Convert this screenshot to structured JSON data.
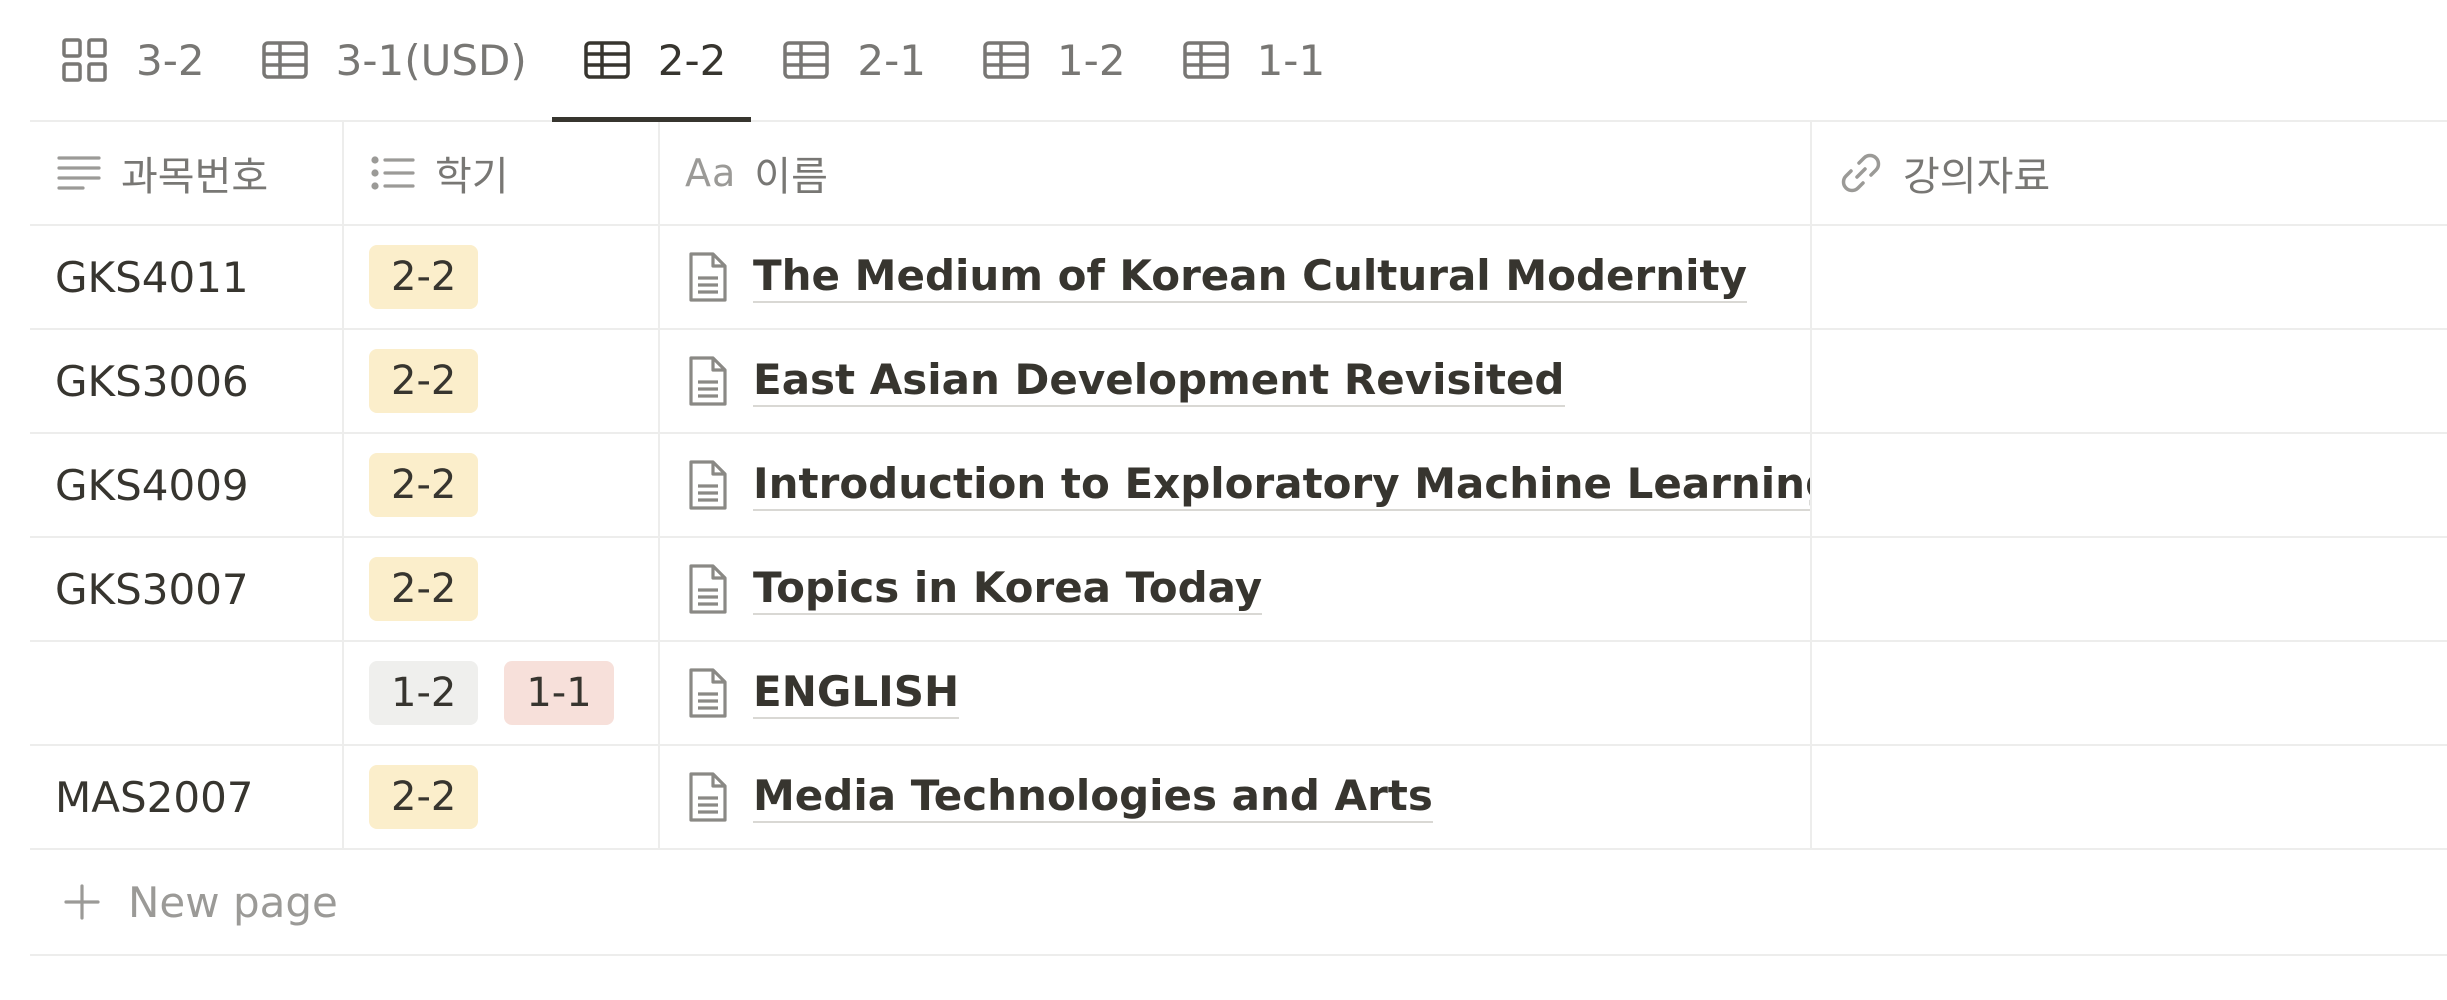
{
  "tabs": [
    {
      "label": "3-2",
      "icon": "board-icon"
    },
    {
      "label": "3-1(USD)",
      "icon": "table-icon"
    },
    {
      "label": "2-2",
      "icon": "table-icon",
      "active": true
    },
    {
      "label": "2-1",
      "icon": "table-icon"
    },
    {
      "label": "1-2",
      "icon": "table-icon"
    },
    {
      "label": "1-1",
      "icon": "table-icon"
    }
  ],
  "columns": {
    "code": {
      "label": "과목번호",
      "icon": "text-lines-icon"
    },
    "semester": {
      "label": "학기",
      "icon": "list-icon"
    },
    "name": {
      "label": "이름",
      "prefix": "Aa"
    },
    "materials": {
      "label": "강의자료",
      "icon": "link-icon"
    }
  },
  "rows": [
    {
      "code": "GKS4011",
      "tags": [
        {
          "text": "2-2",
          "color": "yellow"
        }
      ],
      "name": "The Medium of Korean Cultural Modernity",
      "materials": ""
    },
    {
      "code": "GKS3006",
      "tags": [
        {
          "text": "2-2",
          "color": "yellow"
        }
      ],
      "name": "East Asian Development Revisited",
      "materials": ""
    },
    {
      "code": "GKS4009",
      "tags": [
        {
          "text": "2-2",
          "color": "yellow"
        }
      ],
      "name": "Introduction to Exploratory Machine Learning",
      "materials": ""
    },
    {
      "code": "GKS3007",
      "tags": [
        {
          "text": "2-2",
          "color": "yellow"
        }
      ],
      "name": "Topics in Korea Today",
      "materials": ""
    },
    {
      "code": "",
      "tags": [
        {
          "text": "1-2",
          "color": "gray"
        },
        {
          "text": "1-1",
          "color": "red"
        }
      ],
      "name": "ENGLISH",
      "materials": ""
    },
    {
      "code": "MAS2007",
      "tags": [
        {
          "text": "2-2",
          "color": "yellow"
        }
      ],
      "name": "Media Technologies and Arts",
      "materials": ""
    }
  ],
  "new_page_label": "New page",
  "colors": {
    "yellow": "#fbeecb",
    "gray": "#efefed",
    "red": "#f7e0da",
    "text": "#37352f",
    "muted": "#787774"
  }
}
